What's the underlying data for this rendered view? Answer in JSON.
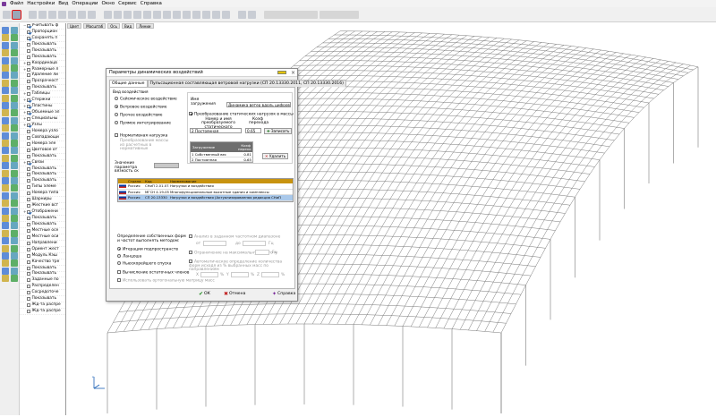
{
  "menu": [
    "Файл",
    "Настройки",
    "Вид",
    "Операции",
    "Окно",
    "Сервис",
    "Справка"
  ],
  "toolbar2": [
    "Цвет",
    "Масштаб",
    "Ось",
    "Вид 3D",
    "Линии",
    "Параметры",
    "Стандарт"
  ],
  "tree": {
    "items": [
      {
        "label": "Учитывать ф",
        "checked": true,
        "expand": "−"
      },
      {
        "label": "Пропорцион",
        "checked": true,
        "expand": ""
      },
      {
        "label": "Сохранять п",
        "checked": true,
        "expand": ""
      },
      {
        "label": "Показывать",
        "checked": false,
        "expand": ""
      },
      {
        "label": "Показывать",
        "checked": false,
        "expand": ""
      },
      {
        "label": "Показывать",
        "checked": false,
        "expand": ""
      },
      {
        "label": "Координацв",
        "checked": false,
        "expand": "+"
      },
      {
        "label": "Размерные л",
        "checked": false,
        "expand": "+"
      },
      {
        "label": "Удаление ли",
        "checked": false,
        "expand": ""
      },
      {
        "label": "Прозрачност",
        "checked": false,
        "expand": ""
      },
      {
        "label": "Показывать",
        "checked": false,
        "expand": ""
      },
      {
        "label": "Таблицы",
        "checked": false,
        "expand": "+"
      },
      {
        "label": "Стержни",
        "checked": true,
        "expand": "+"
      },
      {
        "label": "Пластины",
        "checked": true,
        "expand": "+"
      },
      {
        "label": "Объемные эл",
        "checked": true,
        "expand": "+"
      },
      {
        "label": "Специальны",
        "checked": false,
        "expand": "+"
      },
      {
        "label": "Узлы",
        "checked": true,
        "expand": "+"
      },
      {
        "label": "Номера узло",
        "checked": false,
        "expand": ""
      },
      {
        "label": "Совпадающи",
        "checked": false,
        "expand": ""
      },
      {
        "label": "Номера эле",
        "checked": false,
        "expand": ""
      },
      {
        "label": "Цветовое от",
        "checked": false,
        "expand": ""
      },
      {
        "label": "Показывать",
        "checked": false,
        "expand": ""
      },
      {
        "label": "Связи",
        "checked": true,
        "expand": "+"
      },
      {
        "label": "Показывать",
        "checked": false,
        "expand": ""
      },
      {
        "label": "Показывать",
        "checked": false,
        "expand": ""
      },
      {
        "label": "Показывать",
        "checked": false,
        "expand": ""
      },
      {
        "label": "Типы элеме",
        "checked": false,
        "expand": ""
      },
      {
        "label": "Номера типа",
        "checked": false,
        "expand": ""
      },
      {
        "label": "Шарниры",
        "checked": false,
        "expand": ""
      },
      {
        "label": "Жесткие вст",
        "checked": false,
        "expand": ""
      },
      {
        "label": "Отображени",
        "checked": true,
        "expand": "+"
      },
      {
        "label": "Показывать",
        "checked": false,
        "expand": ""
      },
      {
        "label": "Показывать",
        "checked": false,
        "expand": ""
      },
      {
        "label": "Местные осе",
        "checked": false,
        "expand": ""
      },
      {
        "label": "Местные оси",
        "checked": false,
        "expand": ""
      },
      {
        "label": "Направлени",
        "checked": false,
        "expand": ""
      },
      {
        "label": "Ориент жест",
        "checked": false,
        "expand": ""
      },
      {
        "label": "Модуль Кэш",
        "checked": false,
        "expand": ""
      },
      {
        "label": "Качество тре",
        "checked": false,
        "expand": ""
      },
      {
        "label": "Показывать",
        "checked": false,
        "expand": ""
      },
      {
        "label": "Показывать",
        "checked": false,
        "expand": ""
      },
      {
        "label": "Заданные по",
        "checked": false,
        "expand": ""
      },
      {
        "label": "Распределен",
        "checked": false,
        "expand": ""
      },
      {
        "label": "Сосредоточе",
        "checked": false,
        "expand": ""
      },
      {
        "label": "Показывать",
        "checked": false,
        "expand": ""
      },
      {
        "label": "Жд-та распре",
        "checked": false,
        "expand": ""
      },
      {
        "label": "Жд-та распре",
        "checked": false,
        "expand": ""
      }
    ]
  },
  "dialog": {
    "title": "Параметры динамических воздействий",
    "tabs": [
      "Общие данные",
      "Пульсационная составляющая ветровой нагрузки (СП 20.13330.2011, СП 20.13330.2016)"
    ],
    "impact_group": "Вид воздействия",
    "impacts": [
      {
        "label": "Сейсмическое воздействие",
        "on": false
      },
      {
        "label": "Ветровое воздействие",
        "on": true
      },
      {
        "label": "Прочее воздействие",
        "on": false
      },
      {
        "label": "Прямое интегрирование",
        "on": false
      }
    ],
    "normative": "Нормативная нагрузка",
    "mass_transform": "Преобразование массы из расчетных в нормативные",
    "mass_param": "Значение параметра вязкость ск",
    "load_name_label": "Имя загружения",
    "load_name_value": "Динамика ветер вдоль цифровы",
    "convert_static": "Преобразование статических нагрузок в массы",
    "static_num_label": "Номер и имя преобразуемого статического загружения",
    "coef_label": "Коэф перехода",
    "static_select": "2 Постоянная",
    "coef_value": "0.65",
    "add_button": "Записать",
    "table_header_load": "Загружение",
    "table_header_coef": "Коэф перехо",
    "table_rows": [
      {
        "name": "1 Собственный вес",
        "coef": "0.81"
      },
      {
        "name": "2 Постоянная",
        "coef": "0.65"
      }
    ],
    "delete_button": "Удалить",
    "norm_headers": [
      "Страна",
      "Код",
      "Наименование"
    ],
    "norms": [
      {
        "country": "Россия",
        "code": "СНиП 2.01.07-85*",
        "name": "Нагрузки и воздействия",
        "selected": false
      },
      {
        "country": "Россия",
        "code": "МГСН 4.19-05",
        "name": "Многофункциональные высотные здания и комплексы",
        "selected": false
      },
      {
        "country": "Россия",
        "code": "СП 20.13330",
        "name": "Нагрузки и воздействия (Актуализированная редакция СНиП",
        "selected": true
      }
    ],
    "eigen_label": "Определение собственных форм и частот выполнять методом:",
    "methods": [
      {
        "label": "Итерации подпространств",
        "on": true
      },
      {
        "label": "Ланцоша",
        "on": false
      },
      {
        "label": "Ньюскорейшего спуска",
        "on": false
      }
    ],
    "residual": "Вычисление остаточных членов",
    "use_ortho": "Использовать ортогональную матрицу масс",
    "freq_range_label": "Анализ в заданном частотном диапазоне",
    "from_label": "от",
    "to_label": "до",
    "hz": "Гц",
    "limit_freq": "Ограничение на максимальную частоту",
    "auto_label": "Автоматическое определение количества форм исходя из % выбранных масс по направлениям",
    "pct_labels": [
      "X",
      "Y",
      "Z"
    ],
    "pct_unit": "%",
    "ok": "ОК",
    "cancel": "Отмена",
    "help": "Справка"
  }
}
